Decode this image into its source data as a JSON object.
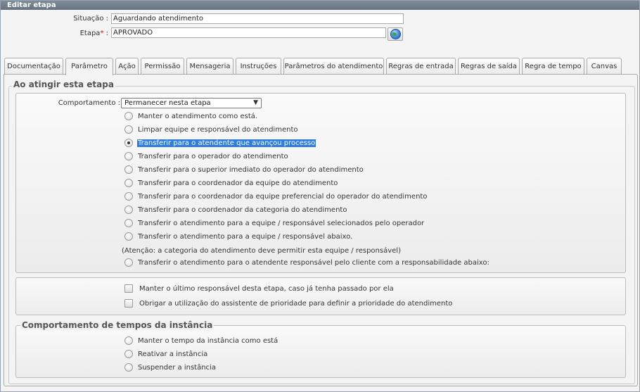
{
  "window": {
    "title": "Editar etapa"
  },
  "form": {
    "situacao_label": "Situação :",
    "situacao_value": "Aguardando atendimento",
    "etapa_label": "Etapa",
    "etapa_required": "*",
    "etapa_colon": " :",
    "etapa_value": "APROVADO"
  },
  "tabs": [
    {
      "label": "Documentação",
      "active": false
    },
    {
      "label": "Parâmetro",
      "active": true
    },
    {
      "label": "Ação",
      "active": false
    },
    {
      "label": "Permissão",
      "active": false
    },
    {
      "label": "Mensageria",
      "active": false
    },
    {
      "label": "Instruções",
      "active": false
    },
    {
      "label": "Parâmetros do atendimento",
      "active": false
    },
    {
      "label": "Regras de entrada",
      "active": false
    },
    {
      "label": "Regras de saída",
      "active": false
    },
    {
      "label": "Regra de tempo",
      "active": false
    },
    {
      "label": "Canvas",
      "active": false
    }
  ],
  "section": {
    "legend": "Ao atingir esta etapa",
    "behavior_label": "Comportamento :",
    "behavior_selected": "Permanecer nesta etapa",
    "behavior_arrow": "▼",
    "options": [
      {
        "label": "Manter o atendimento como está.",
        "checked": false
      },
      {
        "label": "Limpar equipe e responsável do atendimento",
        "checked": false
      },
      {
        "label": "Transferir para o atendente que avançou processo",
        "checked": true
      },
      {
        "label": "Transferir para o operador do atendimento",
        "checked": false
      },
      {
        "label": "Transferir para o superior imediato do operador do atendimento",
        "checked": false
      },
      {
        "label": "Transferir para o coordenador da equipe do atendimento",
        "checked": false
      },
      {
        "label": "Transferir para o coordenador da equipe preferencial do operador do atendimento",
        "checked": false
      },
      {
        "label": "Transferir para o coordenador da categoria do atendimento",
        "checked": false
      },
      {
        "label": "Transferir o atendimento para a equipe / responsável selecionados pelo operador",
        "checked": false
      },
      {
        "label": "Transferir o atendimento para a equipe / responsável abaixo.",
        "checked": false
      }
    ],
    "note": "(Atenção: a categoria do atendimento deve permitir esta equipe / responsável)",
    "last_option": "Transferir o atendimento para o atendente responsável pelo cliente com a responsabilidade abaixo:"
  },
  "checkboxes": [
    {
      "label": "Manter o último responsável desta etapa, caso já tenha passado por ela",
      "checked": false
    },
    {
      "label": "Obrigar a utilização do assistente de prioridade para definir a prioridade do atendimento",
      "checked": false
    }
  ],
  "time_section": {
    "legend": "Comportamento de tempos da instância",
    "options": [
      {
        "label": "Manter o tempo da instância como está",
        "checked": false
      },
      {
        "label": "Reativar a instância",
        "checked": false
      },
      {
        "label": "Suspender a instância",
        "checked": false
      }
    ]
  },
  "colors": {
    "selection": "#2f7de1",
    "titlebar": "#6f7b88",
    "required": "#dd0000"
  }
}
